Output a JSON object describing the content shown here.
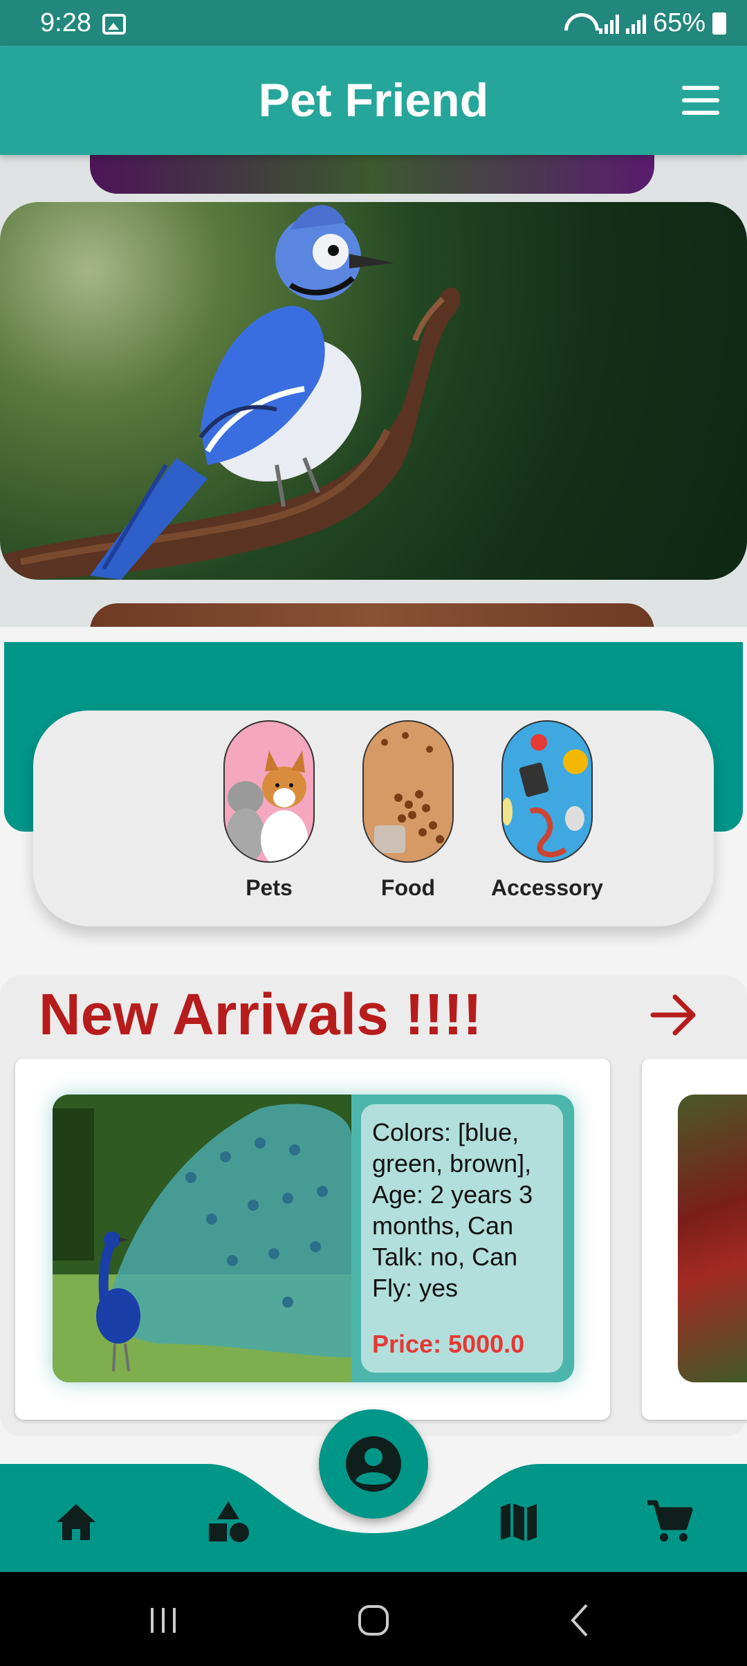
{
  "status_bar": {
    "time": "9:28",
    "battery": "65%"
  },
  "app_bar": {
    "title": "Pet Friend"
  },
  "categories": [
    {
      "label": "Pets"
    },
    {
      "label": "Food"
    },
    {
      "label": "Accessory"
    }
  ],
  "new_arrivals": {
    "title": "New Arrivals !!!!",
    "products": [
      {
        "description": "Colors: [blue, green, brown], Age: 2 years 3 months, Can Talk: no, Can Fly: yes",
        "price": "Price: 5000.0"
      }
    ]
  },
  "icons": {
    "menu": "menu-icon",
    "arrow": "arrow-right-icon",
    "home": "home-icon",
    "category": "category-icon",
    "map": "map-icon",
    "cart": "cart-icon",
    "profile": "account-circle-icon"
  },
  "colors": {
    "primary": "#26a69a",
    "primary_dark": "#009688",
    "accent_red": "#b71c1c",
    "price_red": "#e53935"
  }
}
